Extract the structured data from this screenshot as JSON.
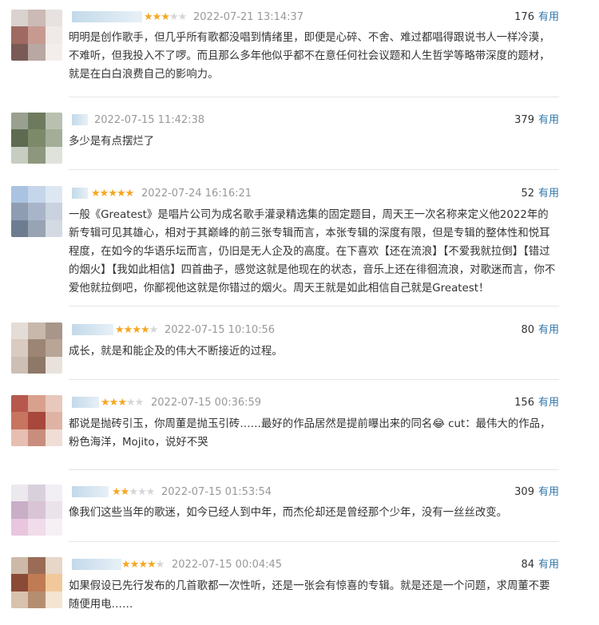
{
  "useful_label": "有用",
  "colors": {
    "star_on": "#f5a623",
    "star_off": "#d6d6d6",
    "link": "#3377aa"
  },
  "reviews": [
    {
      "rating": 3,
      "time": "2022-07-21 13:14:37",
      "votes": "176",
      "content": "明明是创作歌手，但几乎所有歌都没唱到情绪里，即便是心碎、不舍、难过都唱得跟说书人一样冷漠，不难听，但我投入不了啰。而且那么多年他似乎都不在意任何社会议题和人生哲学等略带深度的题材，就是在白白浪费自己的影响力。"
    },
    {
      "rating": 0,
      "time": "2022-07-15 11:42:38",
      "votes": "379",
      "content": "多少是有点摆烂了"
    },
    {
      "rating": 5,
      "time": "2022-07-24 16:16:21",
      "votes": "52",
      "content": "一般《Greatest》是唱片公司为成名歌手灌录精选集的固定题目，周天王一次名称来定义他2022年的新专辑可见其雄心，相对于其巅峰的前三张专辑而言，本张专辑的深度有限，但是专辑的整体性和悦耳程度，在如今的华语乐坛而言，仍旧是无人企及的高度。在下喜欢【还在流浪】【不爱我就拉倒】【错过的烟火】【我如此相信】四首曲子，感觉这就是他现在的状态，音乐上还在徘徊流浪，对歌迷而言，你不爱他就拉倒吧，你鄙视他这就是你错过的烟火。周天王就是如此相信自己就是Greatest！"
    },
    {
      "rating": 4,
      "time": "2022-07-15 10:10:56",
      "votes": "80",
      "content": "成长，就是和能企及的伟大不断接近的过程。"
    },
    {
      "rating": 3,
      "time": "2022-07-15 00:36:59",
      "votes": "156",
      "content": "都说是抛砖引玉，你周董是抛玉引砖……最好的作品居然是提前曝出来的同名😂 cut：最伟大的作品，粉色海洋，Mojito，说好不哭"
    },
    {
      "rating": 2,
      "time": "2022-07-15 01:53:54",
      "votes": "309",
      "content": "像我们这些当年的歌迷，如今已经人到中年，而杰伦却还是曾经那个少年，没有一丝丝改变。"
    },
    {
      "rating": 4,
      "time": "2022-07-15 00:04:45",
      "votes": "84",
      "content": "如果假设已先行发布的几首歌都一次性听，还是一张会有惊喜的专辑。就是还是一个问题，求周董不要随便用电……"
    }
  ]
}
